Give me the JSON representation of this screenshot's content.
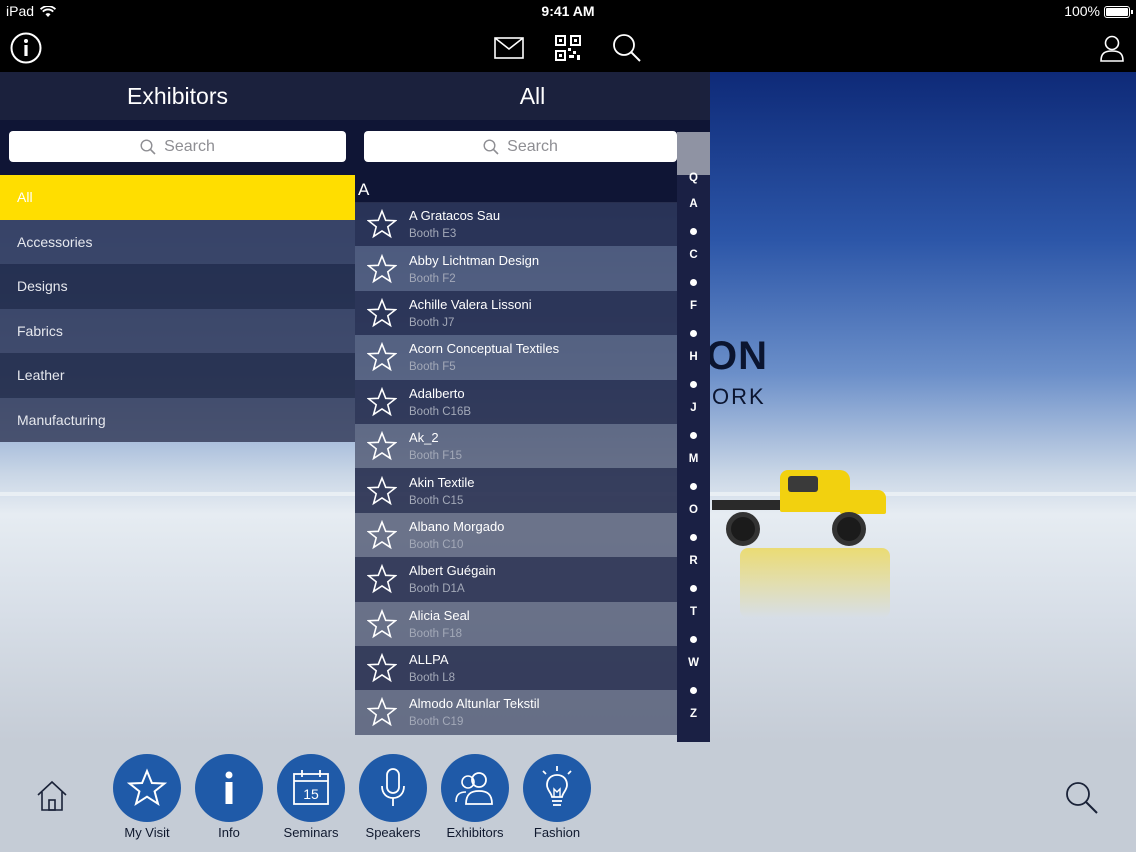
{
  "status_bar": {
    "device": "iPad",
    "time": "9:41 AM",
    "battery": "100%"
  },
  "nav": {
    "icons": [
      "info-icon",
      "mail-icon",
      "qr-code-icon",
      "search-icon",
      "user-icon"
    ]
  },
  "background": {
    "brand_text": "ON",
    "brand_sub": "ORK"
  },
  "categories": {
    "title": "Exhibitors",
    "search_placeholder": "Search",
    "items": [
      {
        "label": "All",
        "selected": true
      },
      {
        "label": "Accessories"
      },
      {
        "label": "Designs"
      },
      {
        "label": "Fabrics"
      },
      {
        "label": "Leather"
      },
      {
        "label": "Manufacturing"
      }
    ]
  },
  "list": {
    "title": "All",
    "search_placeholder": "Search",
    "section": "A",
    "rows": [
      {
        "name": "A Gratacos Sau",
        "booth": "Booth E3"
      },
      {
        "name": "Abby Lichtman Design",
        "booth": "Booth F2"
      },
      {
        "name": "Achille Valera Lissoni",
        "booth": "Booth J7"
      },
      {
        "name": "Acorn Conceptual Textiles",
        "booth": "Booth F5"
      },
      {
        "name": "Adalberto",
        "booth": "Booth C16B"
      },
      {
        "name": "Ak_2",
        "booth": "Booth F15"
      },
      {
        "name": "Akin Textile",
        "booth": "Booth C15"
      },
      {
        "name": "Albano Morgado",
        "booth": "Booth C10"
      },
      {
        "name": "Albert Guégain",
        "booth": "Booth D1A"
      },
      {
        "name": "Alicia Seal",
        "booth": "Booth F18"
      },
      {
        "name": "ALLPA",
        "booth": "Booth L8"
      },
      {
        "name": "Almodo Altunlar Tekstil",
        "booth": "Booth C19"
      }
    ],
    "index": [
      "Q",
      "A",
      "•",
      "C",
      "•",
      "F",
      "•",
      "H",
      "•",
      "J",
      "•",
      "M",
      "•",
      "O",
      "•",
      "R",
      "•",
      "T",
      "•",
      "W",
      "•",
      "Z"
    ]
  },
  "tabs": {
    "items": [
      {
        "label": "My Visit",
        "icon": "star-icon"
      },
      {
        "label": "Info",
        "icon": "info-icon"
      },
      {
        "label": "Seminars",
        "icon": "calendar-icon",
        "badge": "15"
      },
      {
        "label": "Speakers",
        "icon": "microphone-icon"
      },
      {
        "label": "Exhibitors",
        "icon": "people-icon"
      },
      {
        "label": "Fashion",
        "icon": "lightbulb-icon"
      }
    ]
  },
  "colors": {
    "accent": "#ffde00",
    "tab_circle": "#1f5aa8",
    "panel": "#1b213d"
  }
}
